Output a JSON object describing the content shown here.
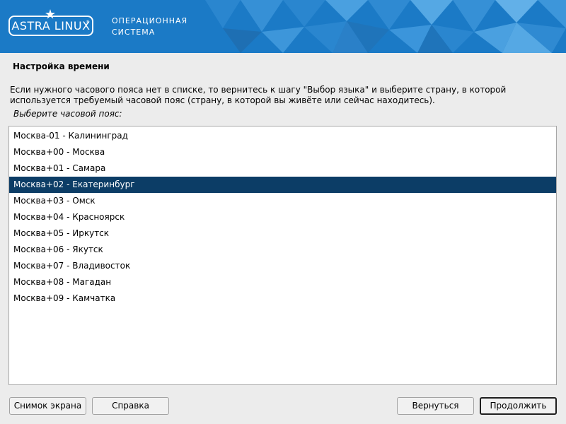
{
  "header": {
    "logo_text": "ASTRA LINUX",
    "logo_reg_mark": "®",
    "os_line1": "ОПЕРАЦИОННАЯ",
    "os_line2": "СИСТЕМА",
    "colors": {
      "banner": "#1b7ac6",
      "selection": "#0c3d66"
    }
  },
  "main": {
    "title": "Настройка времени",
    "info_line1": "Если нужного часового пояса нет в списке, то вернитесь к шагу \"Выбор языка\" и выберите страну, в которой",
    "info_line2": "используется требуемый часовой пояс (страну, в которой вы живёте или сейчас находитесь).",
    "prompt": "Выберите часовой пояс:"
  },
  "timezones": {
    "selected_index": 3,
    "items": [
      "Москва-01 - Калининград",
      "Москва+00 - Москва",
      "Москва+01 - Самара",
      "Москва+02 - Екатеринбург",
      "Москва+03 - Омск",
      "Москва+04 - Красноярск",
      "Москва+05 - Иркутск",
      "Москва+06 - Якутск",
      "Москва+07 - Владивосток",
      "Москва+08 - Магадан",
      "Москва+09 - Камчатка"
    ]
  },
  "buttons": {
    "screenshot": "Снимок экрана",
    "help": "Справка",
    "back": "Вернуться",
    "continue": "Продолжить"
  }
}
